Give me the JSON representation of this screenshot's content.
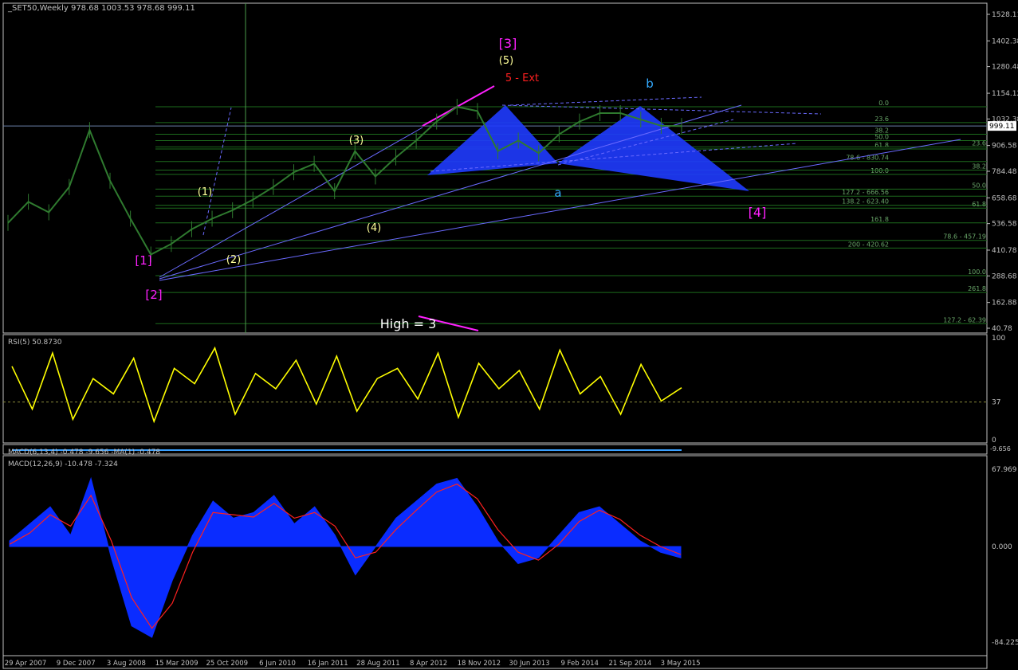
{
  "header": {
    "title": "_SET50,Weekly  978.68 1003.53 978.68 999.11"
  },
  "colors": {
    "bg": "#000000",
    "frame": "#c0c0c0",
    "grid": "#1d6b1d",
    "price": "#2f7a2f",
    "trend": "#6a6aff",
    "fill": "#1f3bff",
    "rsi": "#ffff00",
    "macd": "#0a2cff",
    "signal": "#ff2020",
    "magenta": "#ff20ff",
    "red": "#ff2020",
    "yellow": "#ffff99",
    "cyan": "#33aaff",
    "white": "#ffffff"
  },
  "chart_data": [
    {
      "type": "line",
      "title": "_SET50,Weekly",
      "ohlc": {
        "open": 978.68,
        "high": 1003.53,
        "low": 978.68,
        "close": 999.11
      },
      "y_ticks": [
        1528.11,
        1402.38,
        1280.48,
        1154.12,
        1032.38,
        906.58,
        784.48,
        658.68,
        536.58,
        410.78,
        288.68,
        162.88,
        40.78
      ],
      "current_price": "999.11",
      "x_ticks": [
        "29 Apr 2007",
        "9 Dec 2007",
        "3 Aug 2008",
        "15 Mar 2009",
        "25 Oct 2009",
        "6 Jun 2010",
        "16 Jan 2011",
        "28 Aug 2011",
        "8 Apr 2012",
        "18 Nov 2012",
        "30 Jun 2013",
        "9 Feb 2014",
        "21 Sep 2014",
        "3 May 2015"
      ],
      "x": [
        "2007-04",
        "2007-06",
        "2007-09",
        "2007-12",
        "2008-01",
        "2008-04",
        "2008-08",
        "2008-11",
        "2009-03",
        "2009-06",
        "2009-10",
        "2010-01",
        "2010-06",
        "2010-10",
        "2011-01",
        "2011-04",
        "2011-08",
        "2011-10",
        "2011-12",
        "2012-04",
        "2012-08",
        "2012-11",
        "2013-02",
        "2013-04",
        "2013-06",
        "2013-08",
        "2013-12",
        "2014-03",
        "2014-06",
        "2014-09",
        "2014-11",
        "2015-01",
        "2015-03",
        "2015-05"
      ],
      "series": [
        {
          "values": [
            540,
            640,
            590,
            710,
            980,
            740,
            560,
            390,
            440,
            510,
            560,
            600,
            650,
            710,
            780,
            820,
            690,
            880,
            760,
            850,
            930,
            1020,
            1090,
            1070,
            880,
            930,
            870,
            960,
            1020,
            1060,
            1060,
            1030,
            1000,
            999
          ]
        }
      ],
      "fib_levels": [
        {
          "label": "0.0",
          "value": 1090
        },
        {
          "label": "23.6",
          "value": 1015
        },
        {
          "label": "38.2",
          "value": 960
        },
        {
          "label": "50.0",
          "value": 930
        },
        {
          "label": "61.8",
          "value": 890
        },
        {
          "label": "78.6 - 830.74",
          "value": 830.74
        },
        {
          "label": "100.0",
          "value": 770
        },
        {
          "label": "127.2 - 666.56",
          "value": 666.56
        },
        {
          "label": "138.2 - 623.40",
          "value": 623.4
        },
        {
          "label": "161.8",
          "value": 540
        },
        {
          "label": "200 - 420.62",
          "value": 420.62
        }
      ],
      "fib_levels_2": [
        {
          "label": "23.6",
          "value": 900
        },
        {
          "label": "38.2",
          "value": 790
        },
        {
          "label": "50.0",
          "value": 700
        },
        {
          "label": "61.8",
          "value": 610
        },
        {
          "label": "78.6 - 457.19",
          "value": 457.19
        },
        {
          "label": "100.0",
          "value": 290
        },
        {
          "label": "261.8",
          "value": 210
        },
        {
          "label": "127.2 - 62.39",
          "value": 62.39
        }
      ],
      "wave_labels": [
        {
          "text": "[3]",
          "color": "magenta"
        },
        {
          "text": "(5)",
          "color": "yellow"
        },
        {
          "text": "5 - Ext",
          "color": "red"
        },
        {
          "text": "b",
          "color": "cyan"
        },
        {
          "text": "a",
          "color": "cyan"
        },
        {
          "text": "[4]",
          "color": "magenta"
        },
        {
          "text": "[1]",
          "color": "magenta"
        },
        {
          "text": "[2]",
          "color": "magenta"
        },
        {
          "text": "(1)",
          "color": "yellow"
        },
        {
          "text": "(2)",
          "color": "yellow"
        },
        {
          "text": "(3)",
          "color": "yellow"
        },
        {
          "text": "(4)",
          "color": "yellow"
        },
        {
          "text": "High = 3",
          "color": "white"
        }
      ]
    },
    {
      "type": "line",
      "title": "RSI(5) 50.8730",
      "y_ticks": [
        100,
        37,
        0
      ],
      "series": [
        {
          "name": "RSI(5)",
          "values": [
            72,
            30,
            85,
            20,
            60,
            45,
            80,
            18,
            70,
            55,
            90,
            25,
            65,
            50,
            78,
            35,
            82,
            28,
            60,
            70,
            40,
            85,
            22,
            75,
            50,
            68,
            30,
            88,
            45,
            62,
            25,
            74,
            38,
            51
          ]
        }
      ]
    },
    {
      "type": "line",
      "title": "MACD(6,13,4) -0.478 -9.656 -MA(1) -0.478",
      "right_label": "-9.656"
    },
    {
      "type": "area",
      "title": "MACD(12,26,9) -10.478 -7.324",
      "y_ticks": [
        67.969,
        0.0,
        -84.225
      ],
      "series": [
        {
          "name": "MACD",
          "values": [
            5,
            20,
            35,
            10,
            60,
            -10,
            -70,
            -80,
            -30,
            10,
            40,
            25,
            30,
            45,
            20,
            35,
            10,
            -25,
            0,
            25,
            40,
            55,
            60,
            35,
            5,
            -15,
            -10,
            10,
            30,
            35,
            20,
            5,
            -5,
            -10
          ]
        },
        {
          "name": "Signal",
          "values": [
            2,
            12,
            28,
            18,
            45,
            5,
            -45,
            -72,
            -50,
            -5,
            30,
            28,
            26,
            38,
            25,
            30,
            18,
            -10,
            -5,
            15,
            32,
            48,
            55,
            42,
            15,
            -5,
            -12,
            2,
            22,
            32,
            24,
            10,
            0,
            -7
          ]
        }
      ]
    }
  ]
}
